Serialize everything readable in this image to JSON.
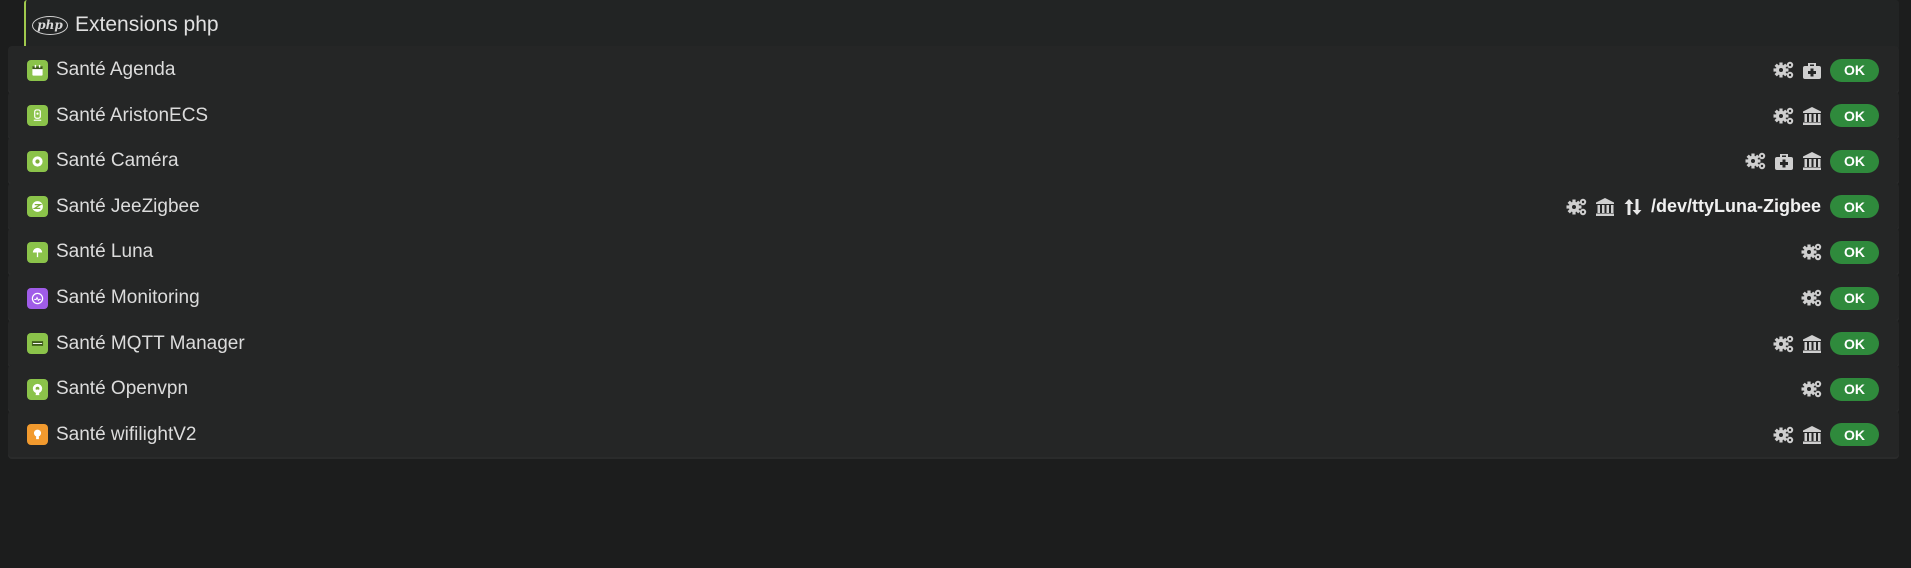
{
  "header": {
    "title": "Extensions php",
    "logo_text": "php"
  },
  "rows": [
    {
      "label": "Santé Agenda",
      "icon": "calendar-icon",
      "icon_color": "#8bc34a",
      "actions": [
        "gears-icon",
        "medkit-icon"
      ],
      "port": "",
      "status": "OK"
    },
    {
      "label": "Santé AristonECS",
      "icon": "boiler-icon",
      "icon_color": "#8bc34a",
      "actions": [
        "gears-icon",
        "bank-icon"
      ],
      "port": "",
      "status": "OK"
    },
    {
      "label": "Santé Caméra",
      "icon": "camera-icon",
      "icon_color": "#8bc34a",
      "actions": [
        "gears-icon",
        "medkit-icon",
        "bank-icon"
      ],
      "port": "",
      "status": "OK"
    },
    {
      "label": "Santé JeeZigbee",
      "icon": "zigbee-icon",
      "icon_color": "#8bc34a",
      "actions": [
        "gears-icon",
        "bank-icon",
        "transfer-icon"
      ],
      "port": "/dev/ttyLuna-Zigbee",
      "status": "OK"
    },
    {
      "label": "Santé Luna",
      "icon": "luna-icon",
      "icon_color": "#8bc34a",
      "actions": [
        "gears-icon"
      ],
      "port": "",
      "status": "OK"
    },
    {
      "label": "Santé Monitoring",
      "icon": "monitoring-icon",
      "icon_color": "#a05ce8",
      "actions": [
        "gears-icon"
      ],
      "port": "",
      "status": "OK"
    },
    {
      "label": "Santé MQTT Manager",
      "icon": "mqtt-icon",
      "icon_color": "#8bc34a",
      "actions": [
        "gears-icon",
        "bank-icon"
      ],
      "port": "",
      "status": "OK"
    },
    {
      "label": "Santé Openvpn",
      "icon": "openvpn-icon",
      "icon_color": "#8bc34a",
      "actions": [
        "gears-icon"
      ],
      "port": "",
      "status": "OK"
    },
    {
      "label": "Santé wifilightV2",
      "icon": "lightbulb-icon",
      "icon_color": "#f29a2e",
      "actions": [
        "gears-icon",
        "bank-icon"
      ],
      "port": "",
      "status": "OK"
    }
  ]
}
